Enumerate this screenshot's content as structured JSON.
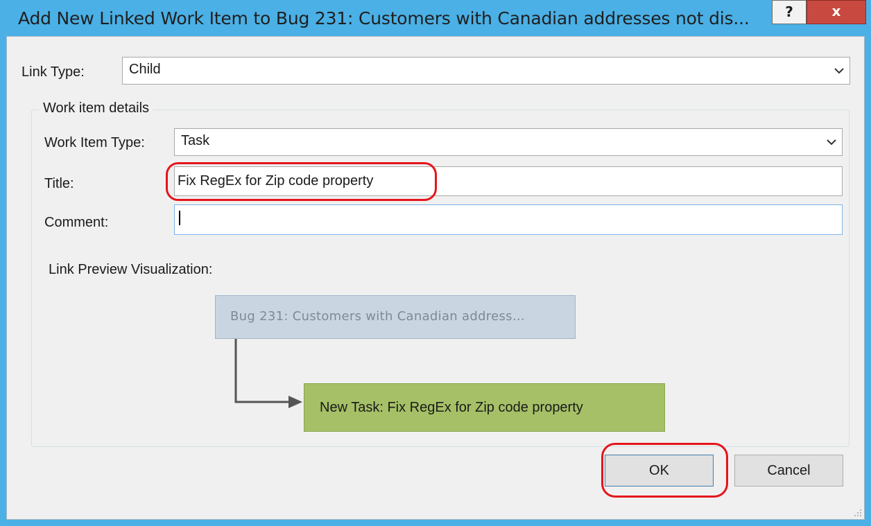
{
  "dialog": {
    "title": "Add New Linked Work Item to Bug 231: Customers with Canadian addresses not dis...",
    "help_label": "?",
    "close_label": "x"
  },
  "link_type": {
    "label": "Link Type:",
    "value": "Child"
  },
  "details": {
    "group_label": "Work item details",
    "work_item_type": {
      "label": "Work Item Type:",
      "value": "Task"
    },
    "title": {
      "label": "Title:",
      "value": "Fix RegEx for Zip code property"
    },
    "comment": {
      "label": "Comment:",
      "value": ""
    }
  },
  "preview": {
    "label": "Link Preview Visualization:",
    "parent_node": "Bug 231: Customers with Canadian address...",
    "child_node": "New Task: Fix RegEx for Zip code property"
  },
  "buttons": {
    "ok": "OK",
    "cancel": "Cancel"
  },
  "colors": {
    "title_bar": "#4ab0e6",
    "close_button": "#c7493f",
    "highlight": "#e5141b",
    "parent_node": "#c9d6e1",
    "child_node": "#a6c067",
    "connector": "#555555"
  },
  "icons": {
    "help": "question-mark-icon",
    "close": "close-icon",
    "dropdown": "chevron-down-icon",
    "connector": "arrow-right-icon",
    "grip": "resize-grip-icon"
  }
}
